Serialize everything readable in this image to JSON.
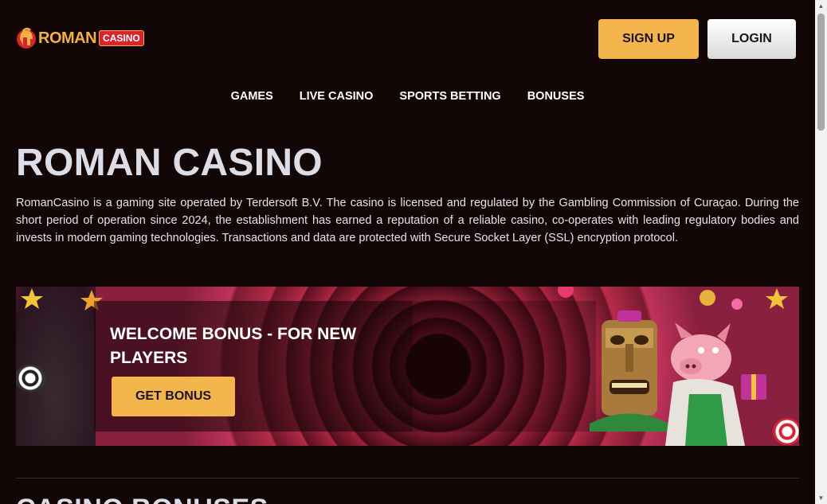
{
  "header": {
    "logo_text": "ROMAN",
    "logo_badge": "CASINO",
    "signup_label": "SIGN UP",
    "login_label": "LOGIN"
  },
  "nav": {
    "items": [
      "GAMES",
      "LIVE CASINO",
      "SPORTS BETTING",
      "BONUSES"
    ]
  },
  "main": {
    "title": "ROMAN CASINO",
    "intro": "RomanCasino is a gaming site operated by Terdersoft B.V. The casino is licensed and regulated by the Gambling Commission of Curaçao. During the short period of operation since 2024, the establishment has earned a reputation of a reliable casino, co-operates with leading regulatory bodies and invests in modern gaming technologies. Transactions and data are protected with Secure Socket Layer (SSL) encryption protocol.",
    "banner": {
      "title": "WELCOME BONUS - FOR NEW PLAYERS",
      "button_label": "GET BONUS"
    },
    "section_heading": "CASINO BONUSES"
  },
  "colors": {
    "background": "#130606",
    "accent": "#f4b54c",
    "brand_red": "#d8242c"
  },
  "icons": {
    "logo": "spartan-helmet-icon",
    "scroll_up": "arrow-up-icon",
    "scroll_down": "arrow-down-icon"
  }
}
